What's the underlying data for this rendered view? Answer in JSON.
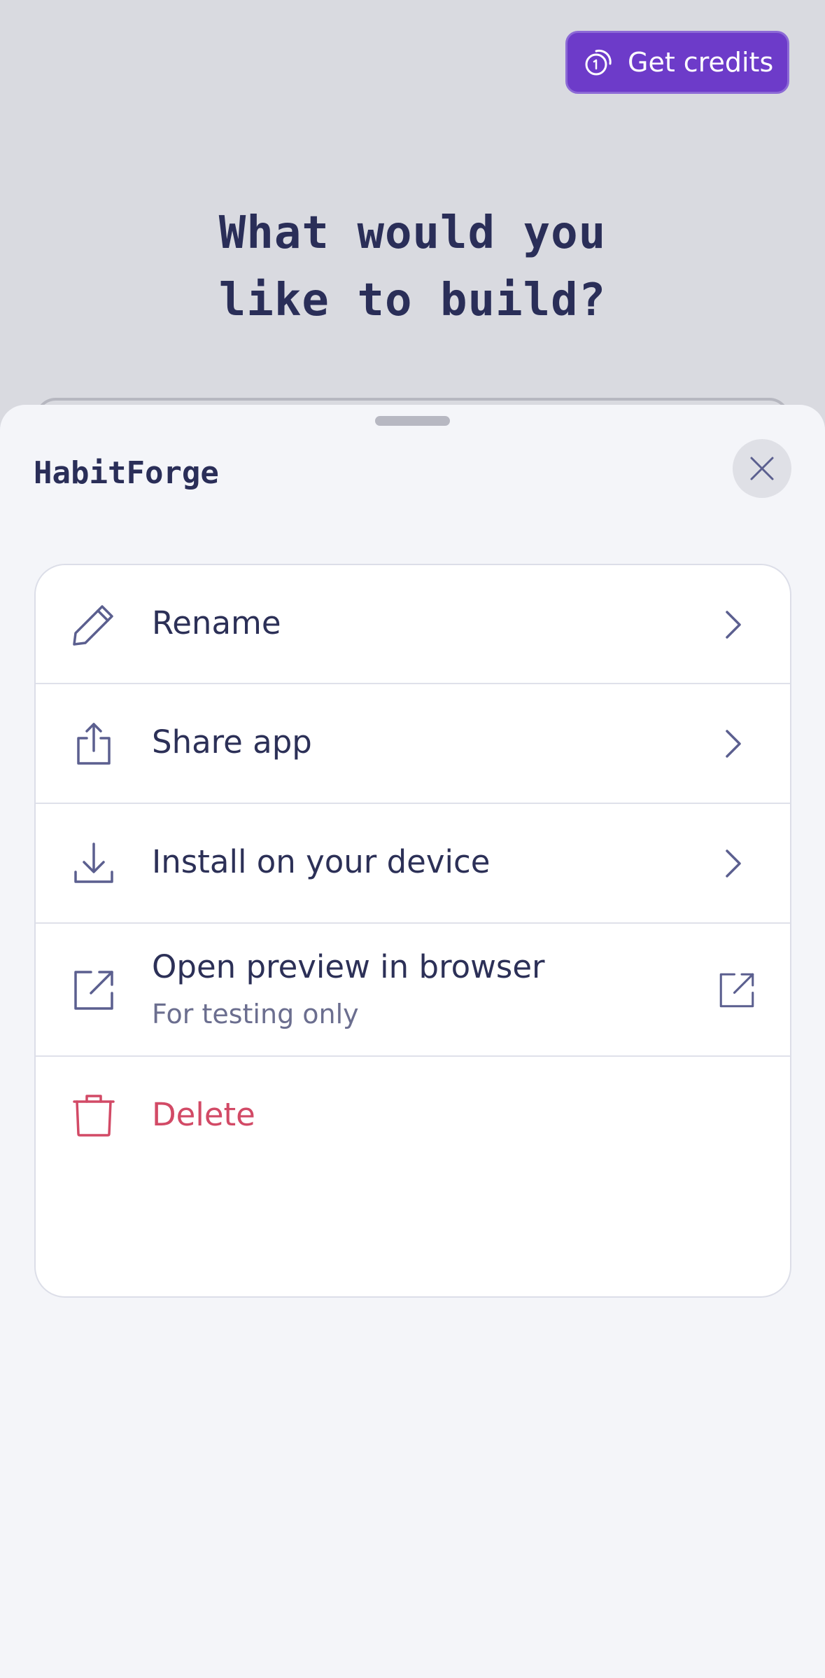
{
  "background": {
    "credits_button": {
      "label": "Get credits",
      "icon": "coin-icon"
    },
    "hero_title_line1": "What would you",
    "hero_title_line2": "like to build?"
  },
  "sheet": {
    "title": "HabitForge",
    "close_icon": "close-icon",
    "items": [
      {
        "label": "Rename",
        "icon": "pencil-icon",
        "trail_icon": "chevron-right-icon"
      },
      {
        "label": "Share app",
        "icon": "share-icon",
        "trail_icon": "chevron-right-icon"
      },
      {
        "label": "Install on your device",
        "icon": "download-icon",
        "trail_icon": "chevron-right-icon"
      },
      {
        "label": "Open preview in browser",
        "sublabel": "For testing only",
        "icon": "external-link-icon",
        "trail_icon": "external-link-icon"
      },
      {
        "label": "Delete",
        "icon": "trash-icon"
      }
    ]
  },
  "colors": {
    "accent": "#6d3bc9",
    "text_primary": "#2a2e58",
    "icon": "#5b5f8f",
    "danger": "#d24a66",
    "sheet_bg": "#f4f5f9",
    "overlay_bg": "#d9dae0"
  }
}
